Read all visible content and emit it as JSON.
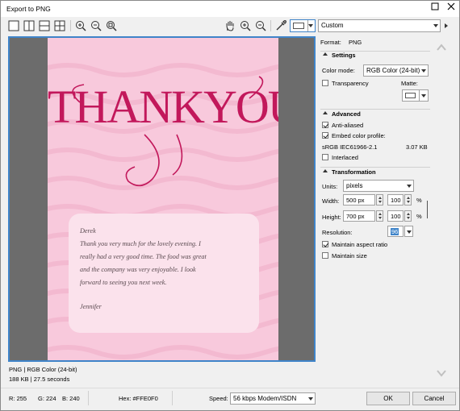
{
  "window": {
    "title": "Export to PNG"
  },
  "toolbar": {
    "preset": "Custom",
    "icons": [
      "single-view-icon",
      "side-by-side-icon",
      "top-bottom-icon",
      "quad-view-icon",
      "zoom-in-icon",
      "zoom-out-icon",
      "zoom-fit-icon",
      "hand-pan-icon",
      "eyedropper-icon"
    ]
  },
  "preview": {
    "heading": "THANKYOU",
    "note_lines": [
      "Derek",
      "Thank you very much for the lovely evening. I",
      "really had a very good time. The food was great",
      "and the company was very enjoyable. I look",
      "forward to seeing you next week."
    ],
    "signature": "Jennifer"
  },
  "format": {
    "label": "Format:",
    "value": "PNG"
  },
  "settings": {
    "header": "Settings",
    "color_mode_label": "Color mode:",
    "color_mode": "RGB Color (24-bit)",
    "transparency": "Transparency",
    "matte_label": "Matte:"
  },
  "advanced": {
    "header": "Advanced",
    "anti_aliased": "Anti-aliased",
    "embed_profile": "Embed color profile:",
    "profile_name": "sRGB IEC61966-2.1",
    "profile_size": "3.07 KB",
    "interlaced": "Interlaced"
  },
  "transformation": {
    "header": "Transformation",
    "units_label": "Units:",
    "units": "pixels",
    "width_label": "Width:",
    "width": "500 px",
    "width_pct": "100",
    "height_label": "Height:",
    "height": "700 px",
    "height_pct": "100",
    "pct_sign": "%",
    "resolution_label": "Resolution:",
    "resolution": "96",
    "maintain_aspect": "Maintain aspect ratio",
    "maintain_size": "Maintain size"
  },
  "info": {
    "line1": "PNG  |  RGB Color (24-bit)",
    "line2": "188 KB  |  27.5 seconds"
  },
  "statusbar": {
    "r": "R: 255",
    "g": "G: 224",
    "b": "B: 240",
    "hex": "Hex: #FFE0F0",
    "speed_label": "Speed:",
    "speed": "56 kbps Modem/ISDN"
  },
  "buttons": {
    "ok": "OK",
    "cancel": "Cancel"
  },
  "colors": {
    "accent": "#3f84c9",
    "card_pink": "#f8c9dc",
    "script_red": "#c2185b",
    "note_bg": "#fbe2ec"
  }
}
